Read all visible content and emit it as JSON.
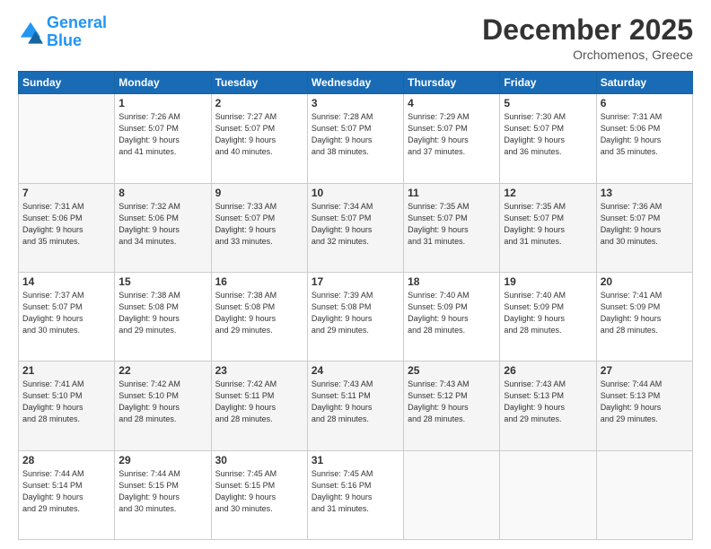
{
  "header": {
    "logo_general": "General",
    "logo_blue": "Blue",
    "month": "December 2025",
    "location": "Orchomenos, Greece"
  },
  "days_of_week": [
    "Sunday",
    "Monday",
    "Tuesday",
    "Wednesday",
    "Thursday",
    "Friday",
    "Saturday"
  ],
  "weeks": [
    [
      {
        "day": "",
        "info": ""
      },
      {
        "day": "1",
        "info": "Sunrise: 7:26 AM\nSunset: 5:07 PM\nDaylight: 9 hours\nand 41 minutes."
      },
      {
        "day": "2",
        "info": "Sunrise: 7:27 AM\nSunset: 5:07 PM\nDaylight: 9 hours\nand 40 minutes."
      },
      {
        "day": "3",
        "info": "Sunrise: 7:28 AM\nSunset: 5:07 PM\nDaylight: 9 hours\nand 38 minutes."
      },
      {
        "day": "4",
        "info": "Sunrise: 7:29 AM\nSunset: 5:07 PM\nDaylight: 9 hours\nand 37 minutes."
      },
      {
        "day": "5",
        "info": "Sunrise: 7:30 AM\nSunset: 5:07 PM\nDaylight: 9 hours\nand 36 minutes."
      },
      {
        "day": "6",
        "info": "Sunrise: 7:31 AM\nSunset: 5:06 PM\nDaylight: 9 hours\nand 35 minutes."
      }
    ],
    [
      {
        "day": "7",
        "info": "Sunrise: 7:31 AM\nSunset: 5:06 PM\nDaylight: 9 hours\nand 35 minutes."
      },
      {
        "day": "8",
        "info": "Sunrise: 7:32 AM\nSunset: 5:06 PM\nDaylight: 9 hours\nand 34 minutes."
      },
      {
        "day": "9",
        "info": "Sunrise: 7:33 AM\nSunset: 5:07 PM\nDaylight: 9 hours\nand 33 minutes."
      },
      {
        "day": "10",
        "info": "Sunrise: 7:34 AM\nSunset: 5:07 PM\nDaylight: 9 hours\nand 32 minutes."
      },
      {
        "day": "11",
        "info": "Sunrise: 7:35 AM\nSunset: 5:07 PM\nDaylight: 9 hours\nand 31 minutes."
      },
      {
        "day": "12",
        "info": "Sunrise: 7:35 AM\nSunset: 5:07 PM\nDaylight: 9 hours\nand 31 minutes."
      },
      {
        "day": "13",
        "info": "Sunrise: 7:36 AM\nSunset: 5:07 PM\nDaylight: 9 hours\nand 30 minutes."
      }
    ],
    [
      {
        "day": "14",
        "info": "Sunrise: 7:37 AM\nSunset: 5:07 PM\nDaylight: 9 hours\nand 30 minutes."
      },
      {
        "day": "15",
        "info": "Sunrise: 7:38 AM\nSunset: 5:08 PM\nDaylight: 9 hours\nand 29 minutes."
      },
      {
        "day": "16",
        "info": "Sunrise: 7:38 AM\nSunset: 5:08 PM\nDaylight: 9 hours\nand 29 minutes."
      },
      {
        "day": "17",
        "info": "Sunrise: 7:39 AM\nSunset: 5:08 PM\nDaylight: 9 hours\nand 29 minutes."
      },
      {
        "day": "18",
        "info": "Sunrise: 7:40 AM\nSunset: 5:09 PM\nDaylight: 9 hours\nand 28 minutes."
      },
      {
        "day": "19",
        "info": "Sunrise: 7:40 AM\nSunset: 5:09 PM\nDaylight: 9 hours\nand 28 minutes."
      },
      {
        "day": "20",
        "info": "Sunrise: 7:41 AM\nSunset: 5:09 PM\nDaylight: 9 hours\nand 28 minutes."
      }
    ],
    [
      {
        "day": "21",
        "info": "Sunrise: 7:41 AM\nSunset: 5:10 PM\nDaylight: 9 hours\nand 28 minutes."
      },
      {
        "day": "22",
        "info": "Sunrise: 7:42 AM\nSunset: 5:10 PM\nDaylight: 9 hours\nand 28 minutes."
      },
      {
        "day": "23",
        "info": "Sunrise: 7:42 AM\nSunset: 5:11 PM\nDaylight: 9 hours\nand 28 minutes."
      },
      {
        "day": "24",
        "info": "Sunrise: 7:43 AM\nSunset: 5:11 PM\nDaylight: 9 hours\nand 28 minutes."
      },
      {
        "day": "25",
        "info": "Sunrise: 7:43 AM\nSunset: 5:12 PM\nDaylight: 9 hours\nand 28 minutes."
      },
      {
        "day": "26",
        "info": "Sunrise: 7:43 AM\nSunset: 5:13 PM\nDaylight: 9 hours\nand 29 minutes."
      },
      {
        "day": "27",
        "info": "Sunrise: 7:44 AM\nSunset: 5:13 PM\nDaylight: 9 hours\nand 29 minutes."
      }
    ],
    [
      {
        "day": "28",
        "info": "Sunrise: 7:44 AM\nSunset: 5:14 PM\nDaylight: 9 hours\nand 29 minutes."
      },
      {
        "day": "29",
        "info": "Sunrise: 7:44 AM\nSunset: 5:15 PM\nDaylight: 9 hours\nand 30 minutes."
      },
      {
        "day": "30",
        "info": "Sunrise: 7:45 AM\nSunset: 5:15 PM\nDaylight: 9 hours\nand 30 minutes."
      },
      {
        "day": "31",
        "info": "Sunrise: 7:45 AM\nSunset: 5:16 PM\nDaylight: 9 hours\nand 31 minutes."
      },
      {
        "day": "",
        "info": ""
      },
      {
        "day": "",
        "info": ""
      },
      {
        "day": "",
        "info": ""
      }
    ]
  ]
}
